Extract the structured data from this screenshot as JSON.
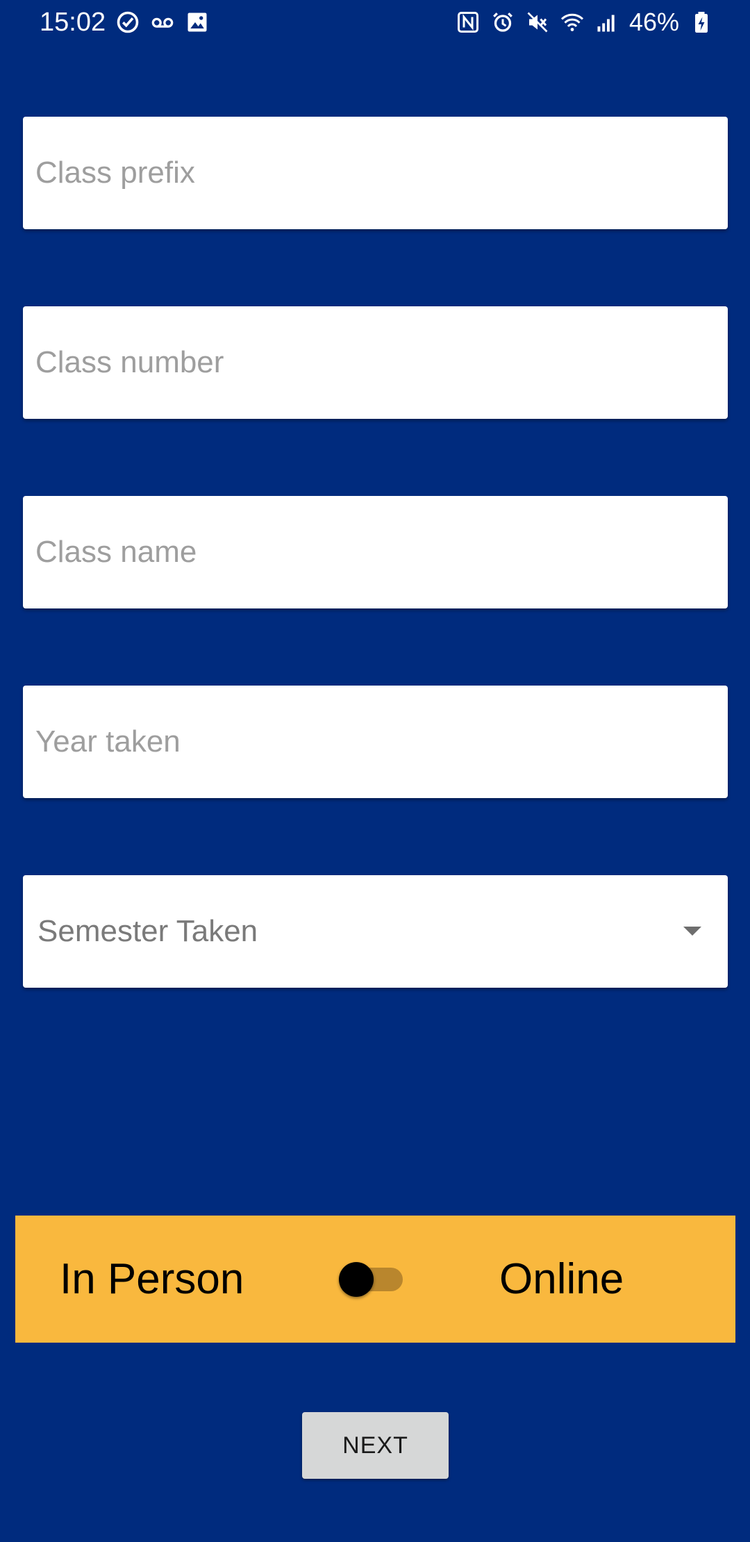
{
  "status_bar": {
    "time": "15:02",
    "battery": "46%",
    "left_icons": [
      "check-circle-icon",
      "voicemail-icon",
      "image-icon"
    ],
    "right_icons": [
      "nfc-icon",
      "alarm-icon",
      "mute-icon",
      "wifi-icon",
      "signal-icon",
      "battery-charging-icon"
    ]
  },
  "form": {
    "class_prefix_placeholder": "Class prefix",
    "class_number_placeholder": "Class number",
    "class_name_placeholder": "Class name",
    "year_taken_placeholder": "Year taken",
    "semester_selected": "Semester Taken"
  },
  "mode": {
    "left_label": "In Person",
    "right_label": "Online",
    "online_enabled": false
  },
  "next_button_label": "NEXT",
  "colors": {
    "background": "#002b7e",
    "mode_bar": "#f9b83e",
    "button": "#d6d7d7"
  }
}
